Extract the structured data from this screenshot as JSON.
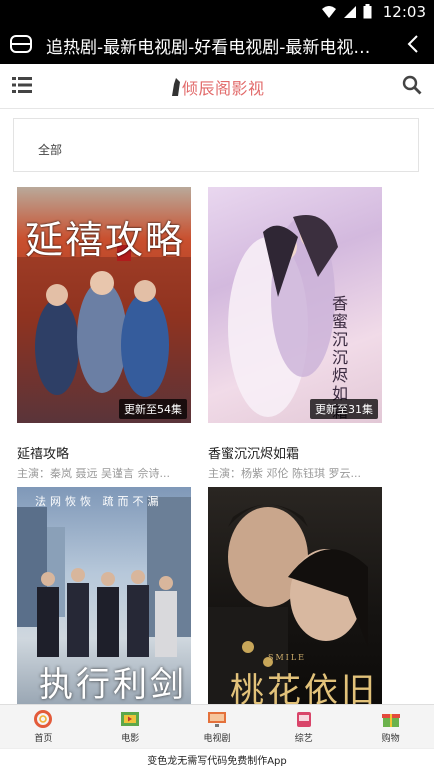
{
  "status_bar": {
    "time": "12:03"
  },
  "titlebar": {
    "title": "追热剧-最新电视剧-好看电视剧-最新电视剧排..."
  },
  "header": {
    "logo_text": "倾辰阁影视"
  },
  "filter": {
    "tag": "全部"
  },
  "items": [
    {
      "title": "延禧攻略",
      "actors": "主演：秦岚 聂远 吴谨言 佘诗...",
      "badge": "更新至54集",
      "poster_text": "延禧攻略"
    },
    {
      "title": "香蜜沉沉烬如霜",
      "actors": "主演：杨紫 邓伦 陈钰琪 罗云...",
      "badge": "更新至31集",
      "poster_text": "香蜜沉沉烬如霜"
    },
    {
      "title": "",
      "actors": "",
      "badge": "",
      "poster_text": "执行利剑",
      "poster_caption": "法网恢恢 疏而不漏"
    },
    {
      "title": "",
      "actors": "",
      "badge": "",
      "poster_text": "桃花依旧",
      "poster_caption": "SMILE"
    }
  ],
  "tabs": [
    {
      "label": "首页",
      "icon": "lifebuoy-icon"
    },
    {
      "label": "电影",
      "icon": "film-icon"
    },
    {
      "label": "电视剧",
      "icon": "tv-icon"
    },
    {
      "label": "综艺",
      "icon": "variety-icon"
    },
    {
      "label": "购物",
      "icon": "gift-icon"
    }
  ],
  "promo": {
    "text": "变色龙无需写代码免费制作App"
  },
  "colors": {
    "brand": "#e26b6b",
    "bar": "#000000"
  }
}
